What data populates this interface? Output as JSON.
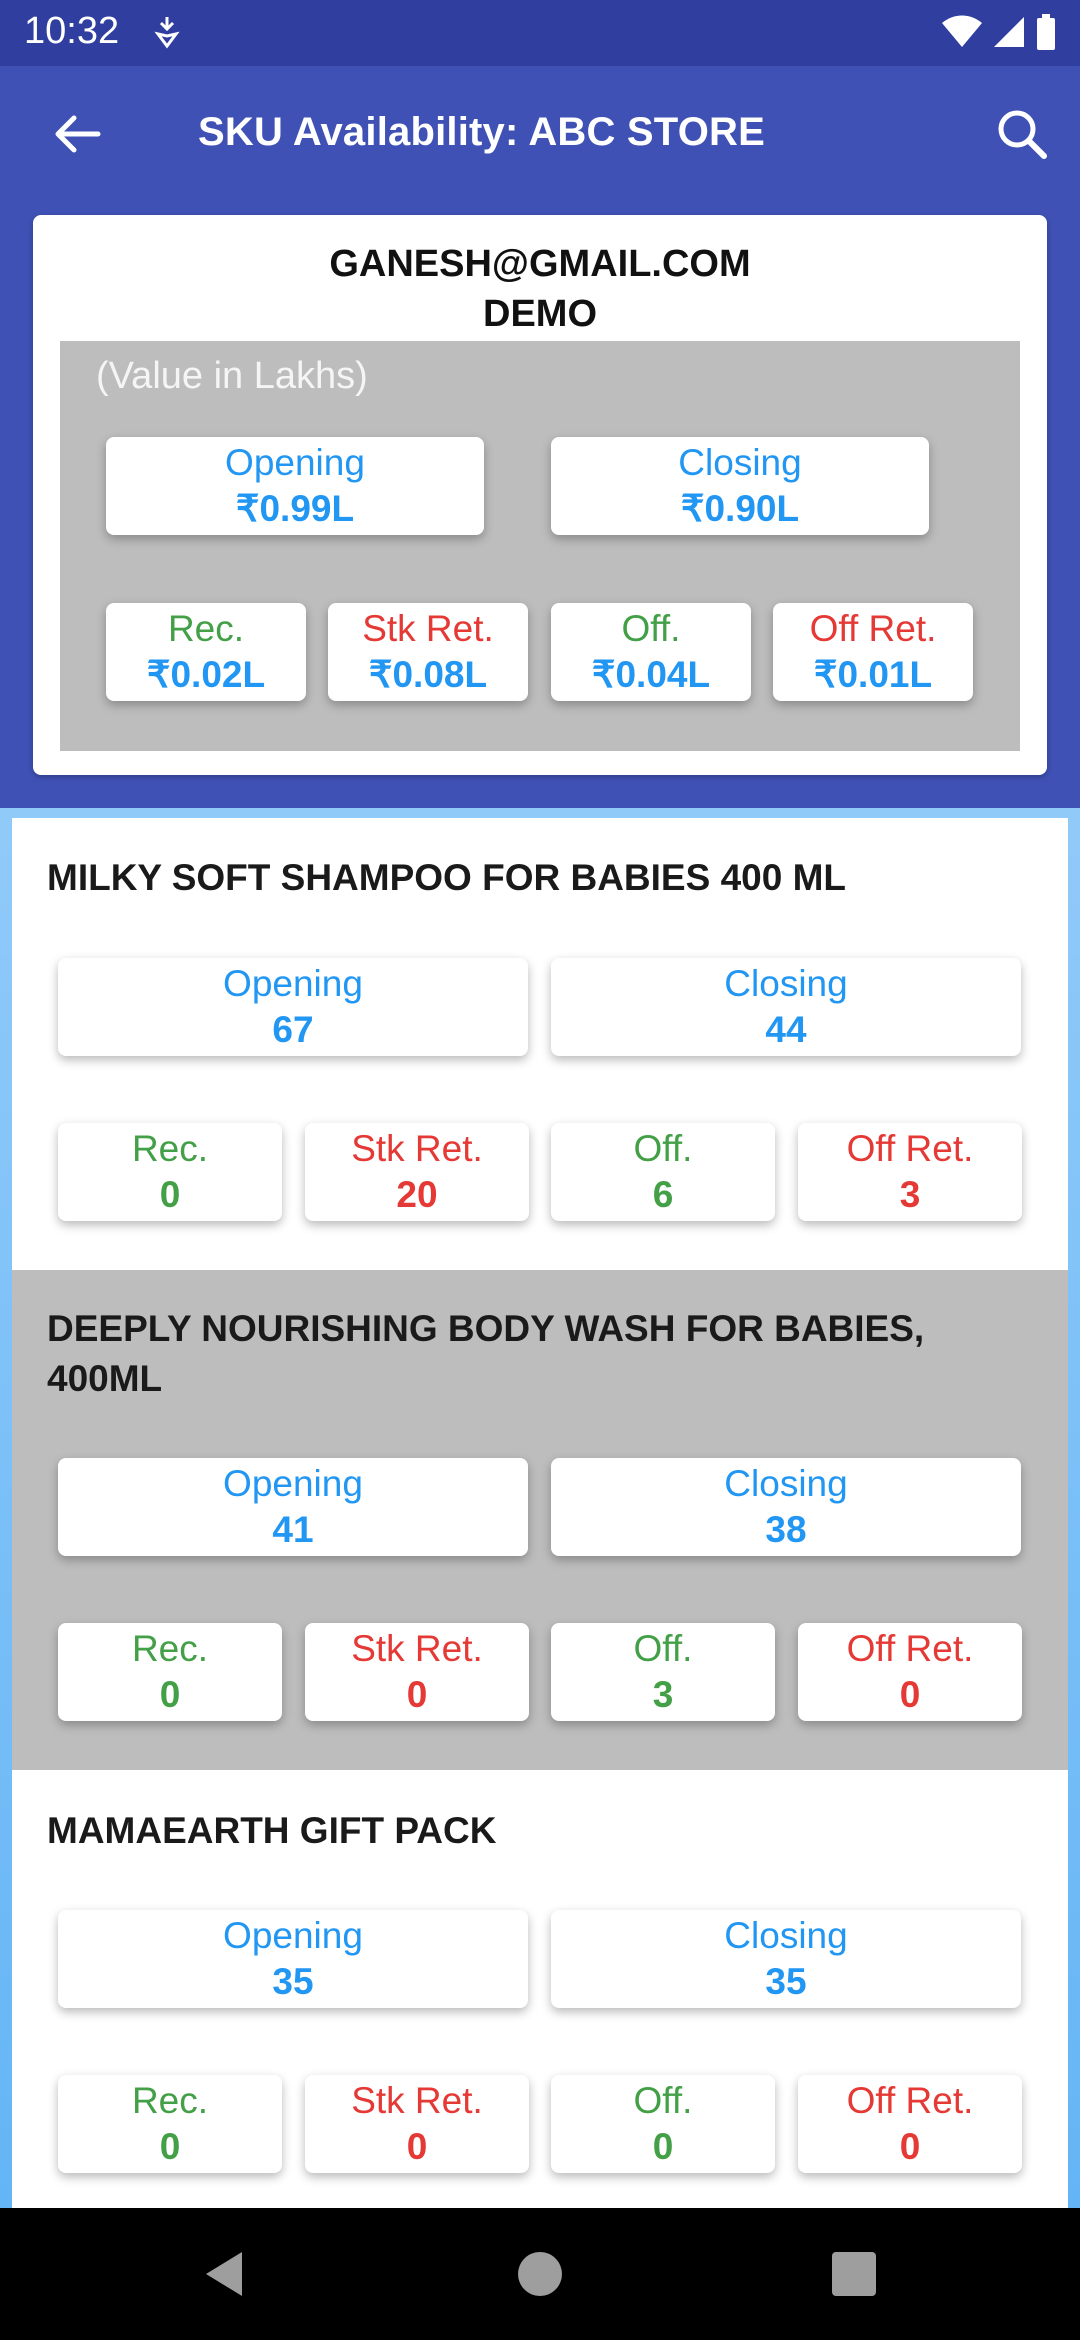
{
  "status_bar": {
    "time": "10:32"
  },
  "app_bar": {
    "title": "SKU Availability: ABC STORE"
  },
  "summary": {
    "email": "GANESH@GMAIL.COM",
    "name": "DEMO",
    "note": "(Value in Lakhs)",
    "opening": {
      "label": "Opening",
      "value": "₹0.99L"
    },
    "closing": {
      "label": "Closing",
      "value": "₹0.90L"
    },
    "rec": {
      "label": "Rec.",
      "value": "₹0.02L"
    },
    "stk_ret": {
      "label": "Stk Ret.",
      "value": "₹0.08L"
    },
    "off": {
      "label": "Off.",
      "value": "₹0.04L"
    },
    "off_ret": {
      "label": "Off Ret.",
      "value": "₹0.01L"
    }
  },
  "skus": [
    {
      "name": "MILKY SOFT SHAMPOO FOR BABIES 400 ML",
      "opening_label": "Opening",
      "opening": "67",
      "closing_label": "Closing",
      "closing": "44",
      "rec_label": "Rec.",
      "rec": "0",
      "stk_ret_label": "Stk Ret.",
      "stk_ret": "20",
      "off_label": "Off.",
      "off": "6",
      "off_ret_label": "Off Ret.",
      "off_ret": "3"
    },
    {
      "name": "DEEPLY NOURISHING BODY WASH FOR BABIES, 400ML",
      "opening_label": "Opening",
      "opening": "41",
      "closing_label": "Closing",
      "closing": "38",
      "rec_label": "Rec.",
      "rec": "0",
      "stk_ret_label": "Stk Ret.",
      "stk_ret": "0",
      "off_label": "Off.",
      "off": "3",
      "off_ret_label": "Off Ret.",
      "off_ret": "0"
    },
    {
      "name": "MAMAEARTH GIFT PACK",
      "opening_label": "Opening",
      "opening": "35",
      "closing_label": "Closing",
      "closing": "35",
      "rec_label": "Rec.",
      "rec": "0",
      "stk_ret_label": "Stk Ret.",
      "stk_ret": "0",
      "off_label": "Off.",
      "off": "0",
      "off_ret_label": "Off Ret.",
      "off_ret": "0"
    }
  ],
  "colors": {
    "primary": "#3f51b5",
    "primary_dark": "#303f9f",
    "blue_text": "#2196f3",
    "green_text": "#43a047",
    "red_text": "#e53935"
  }
}
